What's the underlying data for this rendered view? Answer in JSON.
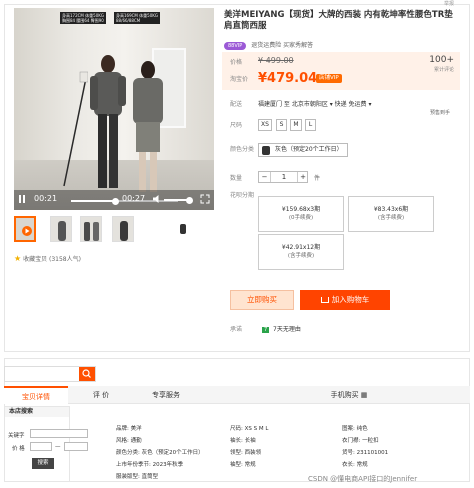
{
  "report": "举报",
  "video": {
    "time_current": "00:21",
    "time_total": "00:27",
    "progress": 0.42,
    "tag_left": "身高172CM 体重50KG\n胸围84 腰围64 臀围90",
    "tag_right": "身高169CM 体重50KG\n88/66/88CM"
  },
  "favorites": "收藏宝贝 (3158人气)",
  "product": {
    "title": "美洋MEIYANG【现货】大牌的西装 内有乾坤率性腰色TR垫肩直筒西服",
    "badge": "88VIP",
    "subline": "退货运费险  买家秀解答"
  },
  "price": {
    "label_price": "价格",
    "old_price": "¥ 499.00",
    "label_promo": "淘宝价",
    "new_price": "¥479.04",
    "vip_tag": "店铺VIP",
    "sales_count": "100+",
    "sales_label": "累计评论"
  },
  "shipping": {
    "label": "配送",
    "text": "福建厦门 至 北京市朝阳区 ▾   快递  免运费 ▾",
    "note": "预售到手"
  },
  "size": {
    "label": "尺码",
    "options": [
      "XS",
      "S",
      "M",
      "L"
    ]
  },
  "color": {
    "label": "颜色分类",
    "option": "灰色（预定20个工作日）"
  },
  "quantity": {
    "label": "数量",
    "minus": "−",
    "value": "1",
    "plus": "+",
    "unit": "件"
  },
  "installments": {
    "label": "花呗分期",
    "plans": [
      {
        "amount": "¥159.68x3期",
        "fee": "(0手续费)"
      },
      {
        "amount": "¥83.43x6期",
        "fee": "(含手续费)"
      },
      {
        "amount": "¥42.91x12期",
        "fee": "(含手续费)"
      }
    ]
  },
  "actions": {
    "buy_now": "立即购买",
    "add_cart": "加入购物车"
  },
  "promise": {
    "label": "承诺",
    "badge": "7",
    "text": "7天无理由"
  },
  "tabs": [
    "宝贝详情",
    "评 价",
    "专享服务",
    "手机购买 ▦"
  ],
  "shop_search": {
    "header": "本店搜索",
    "keyword_label": "关键字",
    "price_label": "价 格",
    "dash": "—",
    "button": "搜索"
  },
  "attributes": [
    "品牌: 美洋",
    "风格: 通勤",
    "颜色分类: 灰色（预定20个工作日）",
    "上市年份季节: 2023年秋季",
    "服装版型: 直筒型",
    "尺码: XS S M L",
    "袖长: 长袖",
    "领型: 西装领",
    "袖型: 常规",
    "图案: 纯色",
    "衣门襟: 一粒扣",
    "货号: 231101001",
    "衣长: 常规"
  ],
  "watermark": "CSDN @懂电商API接口的Jennifer"
}
